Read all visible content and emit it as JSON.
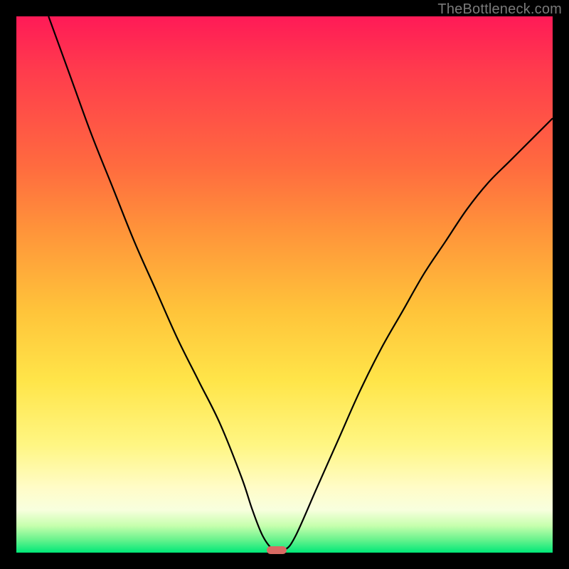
{
  "watermark": "TheBottleneck.com",
  "colors": {
    "frame": "#000000",
    "curve": "#000000",
    "marker": "#d86a63",
    "gradient_stops": [
      "#ff1a57",
      "#ff3b4d",
      "#ff6b3f",
      "#ff943a",
      "#ffc43a",
      "#ffe549",
      "#fff683",
      "#fffcc8",
      "#f8ffde",
      "#c6ffad",
      "#6cf38e",
      "#00e878"
    ]
  },
  "chart_data": {
    "type": "line",
    "title": "",
    "xlabel": "",
    "ylabel": "",
    "xlim": [
      0,
      100
    ],
    "ylim": [
      0,
      100
    ],
    "grid": false,
    "legend": false,
    "series": [
      {
        "name": "bottleneck-curve",
        "x": [
          6,
          10,
          14,
          18,
          22,
          26,
          30,
          34,
          38,
          42,
          44,
          46,
          48,
          50,
          52,
          56,
          60,
          64,
          68,
          72,
          76,
          80,
          84,
          88,
          92,
          96,
          100
        ],
        "values": [
          100,
          89,
          78,
          68,
          58,
          49,
          40,
          32,
          24,
          14,
          8,
          3,
          0.5,
          0.5,
          3,
          12,
          21,
          30,
          38,
          45,
          52,
          58,
          64,
          69,
          73,
          77,
          81
        ]
      }
    ],
    "annotations": [
      {
        "name": "optimal-marker",
        "x": 48.5,
        "y": 0.5,
        "shape": "pill",
        "color": "#d86a63"
      }
    ]
  }
}
